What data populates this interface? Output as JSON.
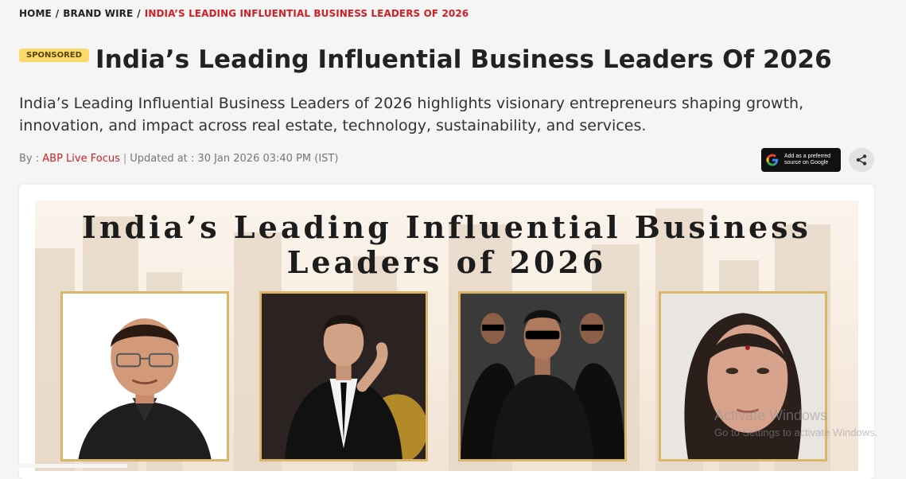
{
  "breadcrumb": {
    "items": [
      "HOME",
      "BRAND WIRE"
    ],
    "current": "INDIA’S LEADING INFLUENTIAL BUSINESS LEADERS OF 2026",
    "separator": "/"
  },
  "article": {
    "badge": "SPONSORED",
    "title": "India’s Leading Influential Business Leaders Of 2026",
    "summary": "India’s Leading Influential Business Leaders of 2026 highlights visionary entrepreneurs shaping growth, innovation, and impact across real estate, technology, sustainability, and services.",
    "by_prefix": "By :",
    "author": "ABP Live Focus",
    "updated_label": "Updated at : 30 Jan 2026 03:40 PM (IST)"
  },
  "actions": {
    "google_line1": "Add as a preferred",
    "google_line2": "source on Google",
    "share_icon": "share-icon"
  },
  "banner": {
    "line1": "India’s Leading Influential Business",
    "line2": "Leaders of 2026",
    "photos": [
      "portrait-1",
      "portrait-2",
      "portrait-3",
      "portrait-4"
    ]
  },
  "watermark": {
    "line1": "Activate Windows",
    "line2": "Go to Settings to activate Windows."
  },
  "colors": {
    "accent": "#d21f26",
    "badge": "#fbd96b",
    "frame": "#d9b66a"
  }
}
